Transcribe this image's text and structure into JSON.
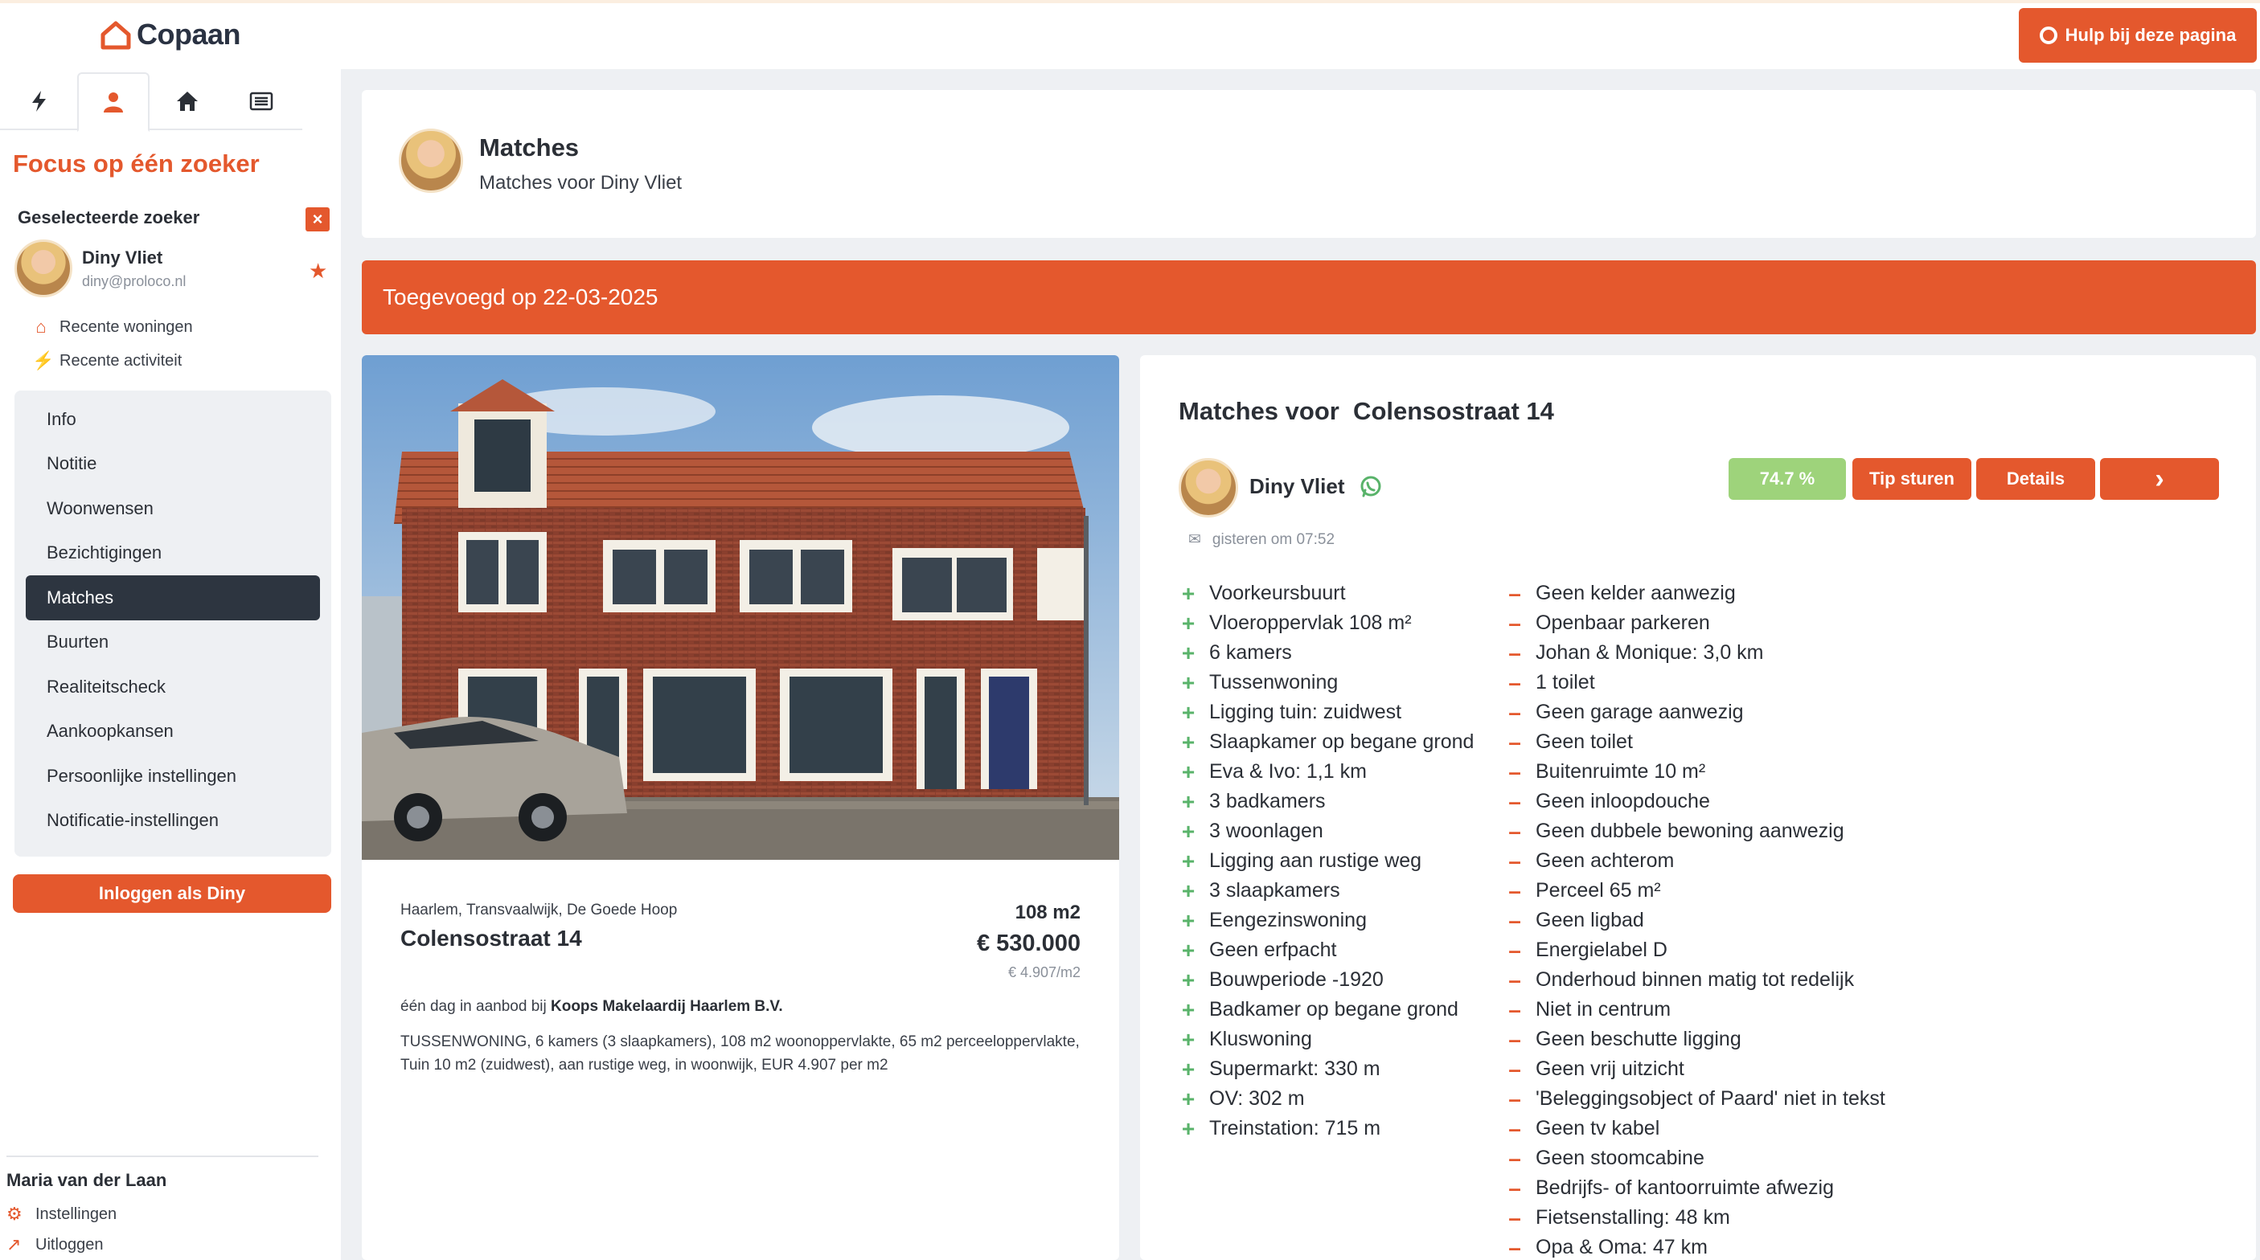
{
  "brand": {
    "name": "Copaan",
    "accent": "#e4582d",
    "dark": "#2d3540",
    "positive": "#59b36a",
    "score": "#9ed37b"
  },
  "topbar": {
    "help_label": "Hulp bij deze pagina",
    "help_icon": "lifebuoy-icon"
  },
  "sidebar": {
    "tabs": [
      {
        "icon": "lightning-icon"
      },
      {
        "icon": "person-icon",
        "active": true
      },
      {
        "icon": "home-icon"
      },
      {
        "icon": "list-icon"
      }
    ],
    "focus_title": "Focus op één zoeker",
    "selected_label": "Geselecteerde zoeker",
    "close_glyph": "×",
    "seeker": {
      "name": "Diny Vliet",
      "email": "diny@proloco.nl"
    },
    "links": [
      {
        "label": "Recente woningen",
        "icon": "home-icon"
      },
      {
        "label": "Recente activiteit",
        "icon": "lightning-icon"
      }
    ],
    "nav": [
      {
        "label": "Info"
      },
      {
        "label": "Notitie"
      },
      {
        "label": "Woonwensen"
      },
      {
        "label": "Bezichtigingen"
      },
      {
        "label": "Matches",
        "active": true
      },
      {
        "label": "Buurten"
      },
      {
        "label": "Realiteitscheck"
      },
      {
        "label": "Aankoopkansen"
      },
      {
        "label": "Persoonlijke instellingen"
      },
      {
        "label": "Notificatie-instellingen"
      }
    ],
    "login_label": "Inloggen als Diny",
    "user": {
      "name": "Maria van der Laan",
      "settings": "Instellingen",
      "logout": "Uitloggen"
    }
  },
  "header": {
    "title": "Matches",
    "subtitle": "Matches voor Diny Vliet"
  },
  "banner": {
    "text": "Toegevoegd op 22-03-2025"
  },
  "listing": {
    "location": "Haarlem, Transvaalwijk, De Goede Hoop",
    "address": "Colensostraat 14",
    "area": "108 m2",
    "price": "€ 530.000",
    "price_per_m2": "€ 4.907/m2",
    "agent_prefix": "één dag in aanbod bij ",
    "agent": "Koops Makelaardij Haarlem B.V.",
    "description": "TUSSENWONING, 6 kamers (3 slaapkamers), 108 m2 woonoppervlakte, 65 m2 perceeloppervlakte, Tuin 10 m2 (zuidwest), aan rustige weg, in woonwijk, EUR 4.907 per m2"
  },
  "matches": {
    "title": "Matches voor  Colensostraat 14",
    "seeker_name": "Diny Vliet",
    "time": "gisteren om 07:52",
    "score": "74.7 %",
    "tip_label": "Tip sturen",
    "details_label": "Details",
    "next_glyph": "›",
    "positives": [
      "Voorkeursbuurt",
      "Vloeroppervlak 108 m²",
      "6 kamers",
      "Tussenwoning",
      "Ligging tuin: zuidwest",
      "Slaapkamer op begane grond",
      "Eva & Ivo: 1,1 km",
      "3 badkamers",
      "3 woonlagen",
      "Ligging aan rustige weg",
      "3 slaapkamers",
      "Eengezinswoning",
      "Geen erfpacht",
      "Bouwperiode -1920",
      "Badkamer op begane grond",
      "Kluswoning",
      "Supermarkt: 330 m",
      "OV: 302 m",
      "Treinstation: 715 m"
    ],
    "negatives": [
      "Geen kelder aanwezig",
      "Openbaar parkeren",
      "Johan & Monique: 3,0 km",
      "1 toilet",
      "Geen garage aanwezig",
      "Geen toilet",
      "Buitenruimte 10 m²",
      "Geen inloopdouche",
      "Geen dubbele bewoning aanwezig",
      "Geen achterom",
      "Perceel 65 m²",
      "Geen ligbad",
      "Energielabel D",
      "Onderhoud binnen matig tot redelijk",
      "Niet in centrum",
      "Geen beschutte ligging",
      "Geen vrij uitzicht",
      "'Beleggingsobject of Paard' niet in tekst",
      "Geen tv kabel",
      "Geen stoomcabine",
      "Bedrijfs- of kantoorruimte afwezig",
      "Fietsenstalling: 48 km",
      "Opa & Oma: 47 km"
    ]
  }
}
